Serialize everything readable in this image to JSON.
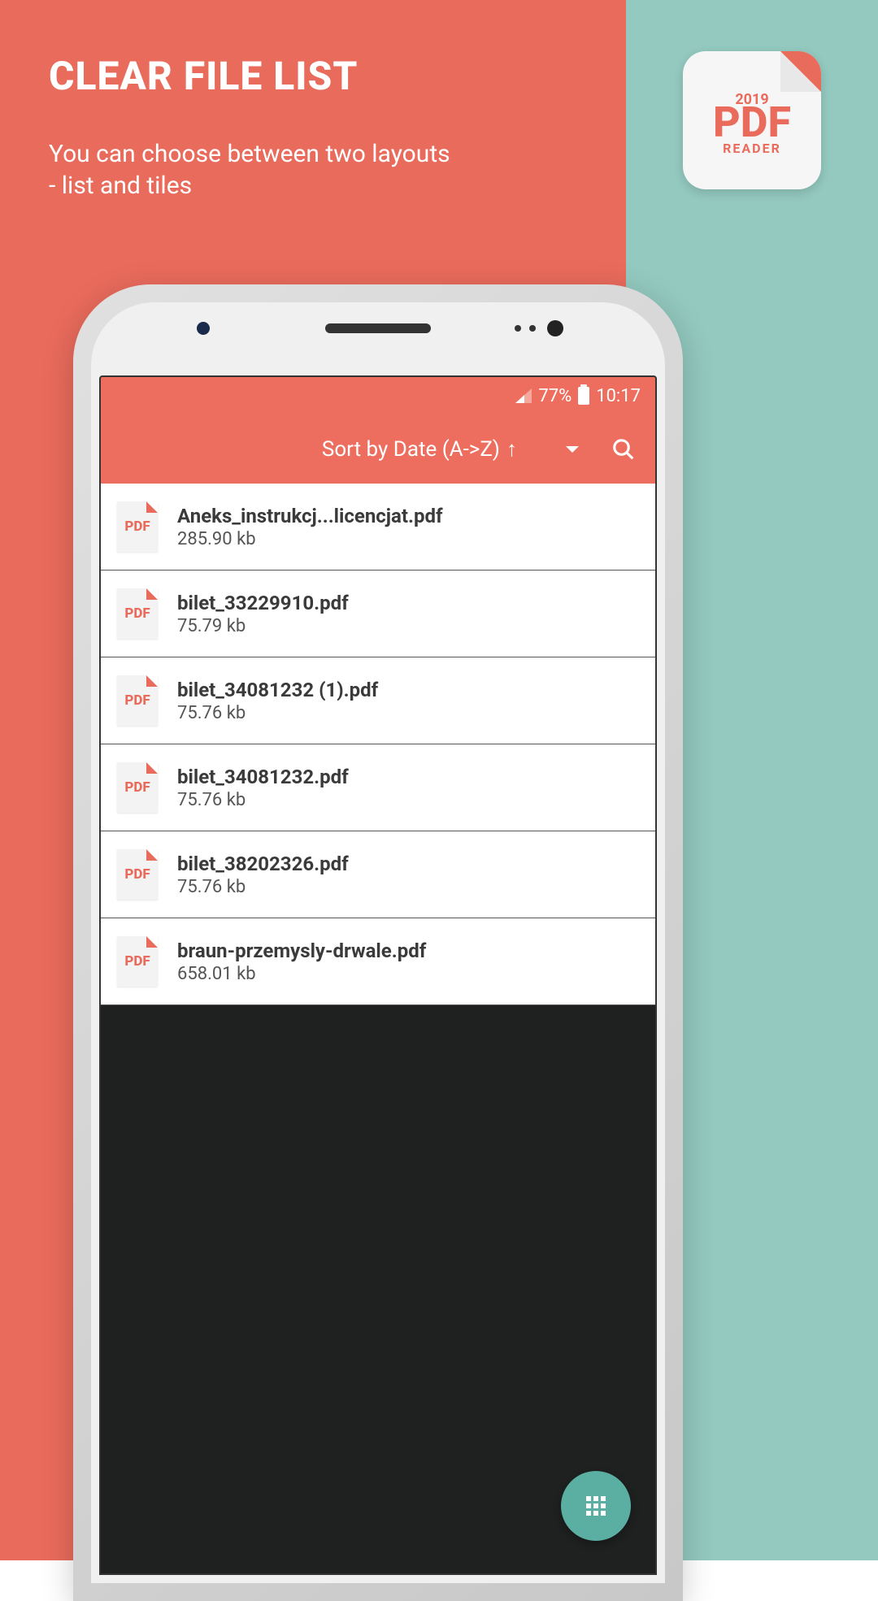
{
  "promo": {
    "title": "CLEAR FILE LIST",
    "subtitle": "You can choose between two layouts - list and tiles"
  },
  "app_icon": {
    "year": "2019",
    "main": "PDF",
    "sub": "READER"
  },
  "status": {
    "battery_percent": "77%",
    "time": "10:17"
  },
  "toolbar": {
    "sort_label": "Sort by Date (A->Z)",
    "sort_arrow": "↑"
  },
  "file_icon_label": "PDF",
  "files": [
    {
      "name": "Aneks_instrukcj...licencjat.pdf",
      "size": "285.90 kb"
    },
    {
      "name": "bilet_33229910.pdf",
      "size": "75.79 kb"
    },
    {
      "name": "bilet_34081232 (1).pdf",
      "size": "75.76 kb"
    },
    {
      "name": "bilet_34081232.pdf",
      "size": "75.76 kb"
    },
    {
      "name": "bilet_38202326.pdf",
      "size": "75.76 kb"
    },
    {
      "name": "braun-przemysly-drwale.pdf",
      "size": "658.01 kb"
    }
  ]
}
